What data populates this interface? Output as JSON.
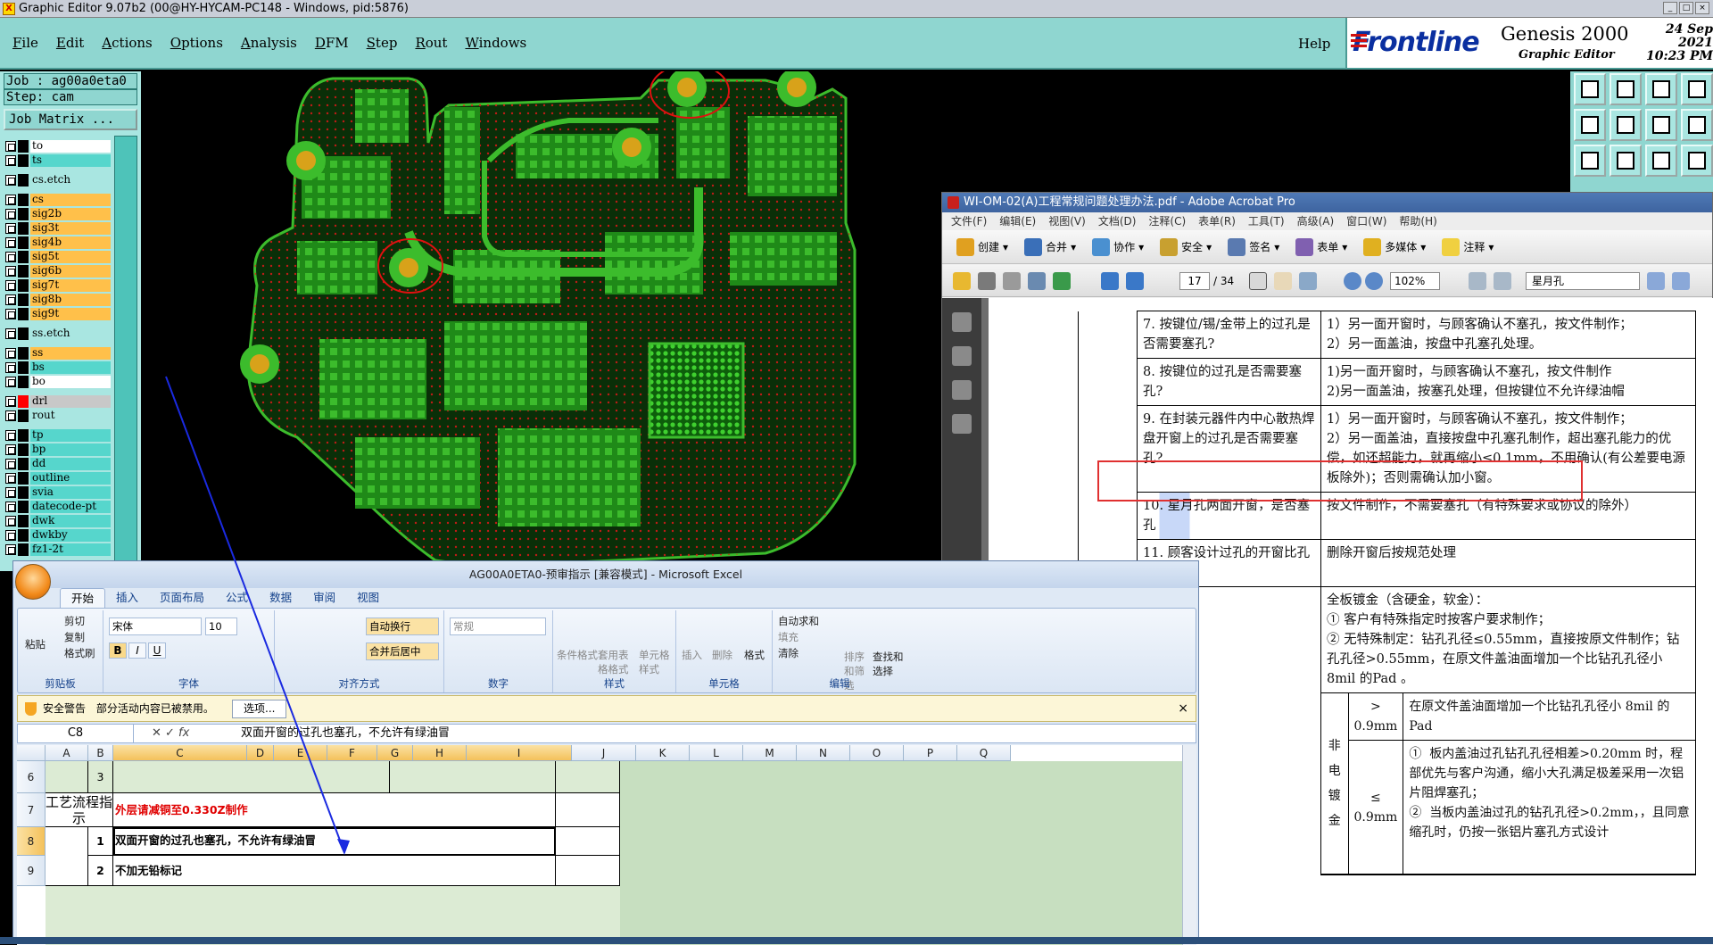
{
  "genesis": {
    "title": "Graphic Editor 9.07b2 (00@HY-HYCAM-PC148 - Windows, pid:5876)",
    "menu": [
      "File",
      "Edit",
      "Actions",
      "Options",
      "Analysis",
      "DFM",
      "Step",
      "Rout",
      "Windows"
    ],
    "help": "Help",
    "brand": {
      "logo": "Frontline",
      "product": "Genesis 2000",
      "subtitle": "Graphic Editor",
      "date": "24 Sep 2021",
      "time": "10:23 PM"
    },
    "job": "Job : ag00a0eta0",
    "step": "Step: cam",
    "job_matrix": "Job Matrix ...",
    "layers": [
      {
        "name": "to",
        "color": "#ffffff",
        "sw": "#000000"
      },
      {
        "name": "ts",
        "color": "#56d6cc",
        "sw": "#000000"
      },
      {
        "name": "cs.etch",
        "color": "#a9e6e1",
        "sw": "#000000",
        "gap": true
      },
      {
        "name": "cs",
        "color": "#ffc04a",
        "sw": "#000000",
        "gap": true
      },
      {
        "name": "sig2b",
        "color": "#ffc04a",
        "sw": "#000000"
      },
      {
        "name": "sig3t",
        "color": "#ffc04a",
        "sw": "#000000"
      },
      {
        "name": "sig4b",
        "color": "#ffc04a",
        "sw": "#000000"
      },
      {
        "name": "sig5t",
        "color": "#ffc04a",
        "sw": "#000000"
      },
      {
        "name": "sig6b",
        "color": "#ffc04a",
        "sw": "#000000"
      },
      {
        "name": "sig7t",
        "color": "#ffc04a",
        "sw": "#000000"
      },
      {
        "name": "sig8b",
        "color": "#ffc04a",
        "sw": "#000000"
      },
      {
        "name": "sig9t",
        "color": "#ffc04a",
        "sw": "#000000"
      },
      {
        "name": "ss.etch",
        "color": "#a9e6e1",
        "sw": "#000000",
        "gap": true
      },
      {
        "name": "ss",
        "color": "#ffc04a",
        "sw": "#000000",
        "gap": true
      },
      {
        "name": "bs",
        "color": "#56d6cc",
        "sw": "#000000"
      },
      {
        "name": "bo",
        "color": "#ffffff",
        "sw": "#000000"
      },
      {
        "name": "drl",
        "color": "#c8c8c8",
        "sw": "#ff0000",
        "gap": true
      },
      {
        "name": "rout",
        "color": "#a9e6e1",
        "sw": "#000000"
      },
      {
        "name": "tp",
        "color": "#56d6cc",
        "sw": "#000000",
        "gap": true
      },
      {
        "name": "bp",
        "color": "#56d6cc",
        "sw": "#000000"
      },
      {
        "name": "dd",
        "color": "#56d6cc",
        "sw": "#000000"
      },
      {
        "name": "outline",
        "color": "#56d6cc",
        "sw": "#000000"
      },
      {
        "name": "svia",
        "color": "#56d6cc",
        "sw": "#000000"
      },
      {
        "name": "datecode-pt",
        "color": "#56d6cc",
        "sw": "#000000"
      },
      {
        "name": "dwk",
        "color": "#56d6cc",
        "sw": "#000000"
      },
      {
        "name": "dwkby",
        "color": "#56d6cc",
        "sw": "#000000"
      },
      {
        "name": "fz1-2t",
        "color": "#56d6cc",
        "sw": "#000000"
      }
    ]
  },
  "acrobat": {
    "title": "WI-OM-02(A)工程常规问题处理办法.pdf - Adobe Acrobat Pro",
    "menu": [
      "文件(F)",
      "编辑(E)",
      "视图(V)",
      "文档(D)",
      "注释(C)",
      "表单(R)",
      "工具(T)",
      "高级(A)",
      "窗口(W)",
      "帮助(H)"
    ],
    "tools": [
      "创建",
      "合并",
      "协作",
      "安全",
      "签名",
      "表单",
      "多媒体",
      "注释"
    ],
    "page": "17",
    "pages_total": "/ 34",
    "zoom": "102%",
    "search": "星月孔",
    "rows": [
      {
        "q": "7.  按键位/锡/金带上的过孔是否需要塞孔?",
        "a": "1）另一面开窗时，与顾客确认不塞孔，按文件制作；\n2）另一面盖油，按盘中孔塞孔处理。"
      },
      {
        "q": "8.  按键位的过孔是否需要塞孔?",
        "a": "1)另一面开窗时，与顾客确认不塞孔，按文件制作\n2)另一面盖油，按塞孔处理，但按键位不允许绿油帽"
      },
      {
        "q": "9.  在封装元器件内中心散热焊盘开窗上的过孔是否需要塞孔?",
        "a": "1）另一面开窗时，与顾客确认不塞孔，按文件制作；\n2）另一面盖油，直接按盘中孔塞孔制作，超出塞孔能力的优偿，如还超能力，就再缩小≤0.1mm，不用确认(有公差要电源板除外)；否则需确认加小窗。"
      },
      {
        "q": "10.  星月孔两面开窗，是否塞孔",
        "a": "按文件制作，不需要塞孔（有特殊要求或协议的除外）"
      },
      {
        "q": "11.  顾客设计过孔的开窗比孔小,",
        "a": "删除开窗后按规范处理"
      }
    ],
    "plating": {
      "intro": "全板镀金（含硬金，软金）：",
      "i1": "①  客户有特殊指定时按客户要求制作；",
      "i2": "②  无特殊制定：钻孔孔径≤0.55mm，直接按原文件制作；钻孔孔径>0.55mm，在原文件盖油面增加一个比钻孔孔径小 8mil 的Pad 。",
      "side": "非电镀金",
      "gt": "> 0.9mm",
      "gt_text": "在原文件盖油面增加一个比钻孔孔径小 8mil 的Pad",
      "le": "≤ 0.9mm",
      "le_text": "①  板内盖油过孔钻孔孔径相差>0.20mm 时，程部优先与客户沟通，缩小大孔满足极差采用一次铝片阻焊塞孔；\n②  当板内盖油过孔的钻孔孔径>0.2mm，，且同意缩孔时，仍按一张铝片塞孔方式设计"
    }
  },
  "excel": {
    "title": "AG00A0ETA0-预审指示 [兼容模式] - Microsoft Excel",
    "tabs": [
      "开始",
      "插入",
      "页面布局",
      "公式",
      "数据",
      "审阅",
      "视图"
    ],
    "active_tab": "开始",
    "clipboard": {
      "paste": "粘贴",
      "cut": "剪切",
      "copy": "复制",
      "format_painter": "格式刷",
      "label": "剪贴板"
    },
    "font": {
      "name": "宋体",
      "size": "10",
      "label": "字体",
      "bold": "B",
      "italic": "I",
      "underline": "U"
    },
    "align": {
      "wrap": "自动换行",
      "merge": "合并后居中",
      "label": "对齐方式"
    },
    "number": {
      "format": "常规",
      "label": "数字"
    },
    "styles": {
      "cond": "条件格式",
      "table": "套用表格格式",
      "cell": "单元格样式",
      "label": "样式"
    },
    "cells": {
      "insert": "插入",
      "delete": "删除",
      "format": "格式",
      "label": "单元格"
    },
    "edit": {
      "autosum": "自动求和",
      "fill": "填充",
      "clear": "清除",
      "sort": "排序和筛选",
      "find": "查找和选择",
      "label": "编辑"
    },
    "security": {
      "title": "安全警告",
      "msg": "部分活动内容已被禁用。",
      "options": "选项..."
    },
    "namebox": "C8",
    "formula": "双面开窗的过孔也塞孔，不允许有绿油冒",
    "columns": [
      "A",
      "B",
      "C",
      "D",
      "E",
      "F",
      "G",
      "H",
      "I",
      "J",
      "K",
      "L",
      "M",
      "N",
      "O",
      "P",
      "Q"
    ],
    "rows": [
      {
        "num": "6",
        "b": "3",
        "c": ""
      },
      {
        "num": "7",
        "a": "工艺流程指示",
        "c": "外层请减铜至0.330Z制作"
      },
      {
        "num": "8",
        "b": "1",
        "c": "双面开窗的过孔也塞孔，不允许有绿油冒"
      },
      {
        "num": "9",
        "b": "2",
        "c": "不加无铅标记"
      }
    ]
  }
}
